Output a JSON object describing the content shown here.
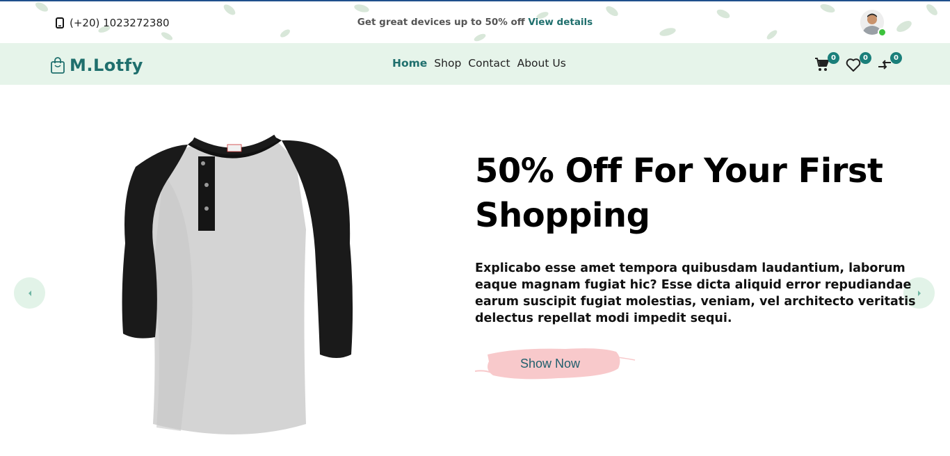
{
  "topbar": {
    "phone": "(+20) 1023272380",
    "promo_text": "Get great devices up to 50% off",
    "promo_link": "View details"
  },
  "nav": {
    "logo": "M.Lotfy",
    "links": [
      "Home",
      "Shop",
      "Contact",
      "About Us"
    ],
    "active": "Home",
    "cart_count": "0",
    "wishlist_count": "0",
    "compare_count": "0"
  },
  "hero": {
    "title": "50% Off For Your First Shopping",
    "description": "Explicabo esse amet tempora quibusdam laudantium, laborum eaque magnam fugiat hic? Esse dicta aliquid error repudiandae earum suscipit fugiat molestias, veniam, vel architecto veritatis delectus repellat modi impedit sequi.",
    "button": "Show Now"
  },
  "colors": {
    "brand": "#1f6f6d",
    "nav_bg": "#e6f4ea",
    "badge": "#1a7f7a",
    "cta_brush": "#f8c9cb",
    "arrow_bg": "#e2f3e8"
  },
  "icons": {
    "phone": "phone-icon",
    "logo": "shopping-bag-icon",
    "cart": "cart-icon",
    "wishlist": "heart-icon",
    "compare": "compare-arrows-icon",
    "prev": "chevron-left-icon",
    "next": "chevron-right-icon"
  }
}
